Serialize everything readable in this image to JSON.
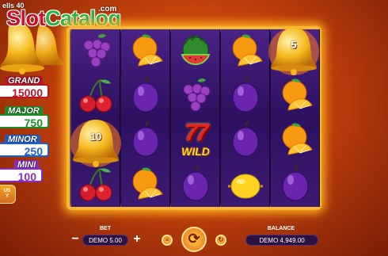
{
  "header": {
    "game_title": "ells 40",
    "watermark_part1": "Slot",
    "watermark_part2": "Catalog",
    "watermark_tld": ".com"
  },
  "jackpots": [
    {
      "name": "GRAND",
      "value": "15000",
      "color": "#b81622"
    },
    {
      "name": "MAJOR",
      "value": "750",
      "color": "#1f8c2a"
    },
    {
      "name": "MINOR",
      "value": "250",
      "color": "#1f5fc8"
    },
    {
      "name": "MINI",
      "value": "100",
      "color": "#8a2cc2"
    }
  ],
  "bonus_buy": {
    "line1": "US",
    "line2": "Y"
  },
  "reels": [
    [
      "grapes",
      "cherries",
      "bell-10",
      "cherries"
    ],
    [
      "orange",
      "plum",
      "plum",
      "orange"
    ],
    [
      "watermelon",
      "grapes",
      "wild-77",
      "plum"
    ],
    [
      "orange",
      "plum",
      "plum",
      "lemon"
    ],
    [
      "bell-5",
      "orange",
      "orange",
      "plum"
    ]
  ],
  "symbols": {
    "bell_left_value": "10",
    "bell_right_value": "5",
    "wild_top": "77",
    "wild_label": "WILD"
  },
  "bottom": {
    "bet_label": "BET",
    "bet_value": "DEMO 5.00",
    "minus_icon": "minus",
    "plus_icon": "plus",
    "balance_label": "BALANCE",
    "balance_value": "DEMO 4,949.00",
    "spin_icon": "spin-arrows",
    "autoplay_icon": "autoplay",
    "turbo_icon": "turbo"
  },
  "colors": {
    "frame": "#f7b733",
    "reel_bg": "#2c1160",
    "background": "#c2410c"
  }
}
